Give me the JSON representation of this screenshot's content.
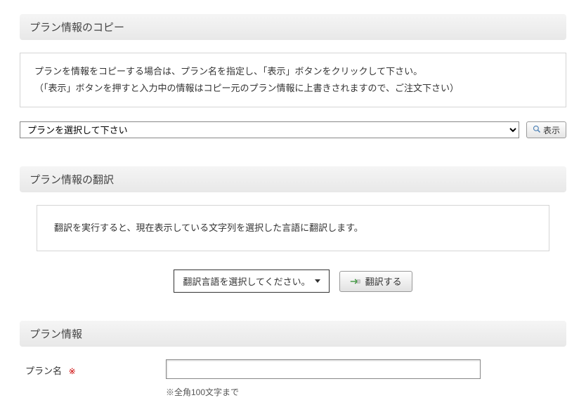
{
  "sections": {
    "copy": {
      "title": "プラン情報のコピー",
      "info_line1": "プランを情報をコピーする場合は、プラン名を指定し、「表示」ボタンをクリックして下さい。",
      "info_line2": "（「表示」ボタンを押すと入力中の情報はコピー元のプラン情報に上書きされますので、ご注文下さい）",
      "select_placeholder": "プランを選択して下さい",
      "display_button": "表示"
    },
    "translate": {
      "title": "プラン情報の翻訳",
      "info": "翻訳を実行すると、現在表示している文字列を選択した言語に翻訳します。",
      "select_placeholder": "翻訳言語を選択してください。",
      "translate_button": "翻訳する"
    },
    "plan": {
      "title": "プラン情報",
      "name_label": "プラン名",
      "required": "※",
      "name_note": "※全角100文字まで",
      "name_value": ""
    }
  }
}
